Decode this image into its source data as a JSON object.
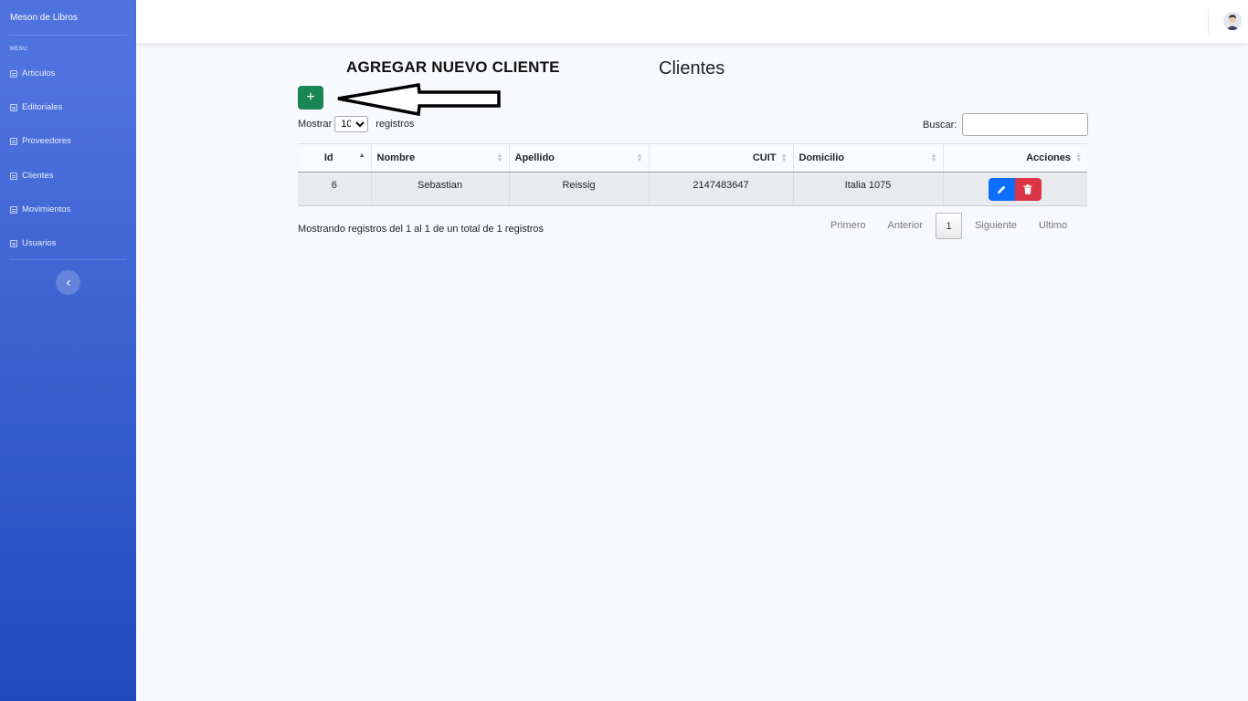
{
  "sidebar": {
    "brand": "Meson de Libros",
    "heading": "MENU",
    "items": [
      {
        "label": "Articulos",
        "icon": "list-icon"
      },
      {
        "label": "Editoriales",
        "icon": "list-icon"
      },
      {
        "label": "Proveedores",
        "icon": "list-icon"
      },
      {
        "label": "Clientes",
        "icon": "list-icon"
      },
      {
        "label": "Movimientos",
        "icon": "list-icon"
      },
      {
        "label": "Usuarios",
        "icon": "list-icon"
      }
    ],
    "toggle_icon": "chevron-left-icon"
  },
  "topbar": {
    "avatar_icon": "user-avatar-icon"
  },
  "page": {
    "title": "Clientes",
    "annotation": "AGREGAR NUEVO CLIENTE",
    "add_label": "+"
  },
  "table_controls": {
    "show_label": "Mostrar",
    "show_value": "10",
    "show_suffix": "registros",
    "search_label": "Buscar:",
    "search_value": ""
  },
  "table": {
    "headers": [
      "Id",
      "Nombre",
      "Apellido",
      "CUIT",
      "Domicilio",
      "Acciones"
    ],
    "rows": [
      {
        "id": "6",
        "nombre": "Sebastian",
        "apellido": "Reissig",
        "cuit": "2147483647",
        "domicilio": "Italia 1075"
      }
    ]
  },
  "footer": {
    "info": "Mostrando registros del 1 al 1 de un total de 1 registros",
    "pager": {
      "first": "Primero",
      "prev": "Anterior",
      "current": "1",
      "next": "Siguiente",
      "last": "Ultimo"
    }
  },
  "colors": {
    "sidebar_top": "#4e73df",
    "sidebar_bottom": "#224abe",
    "add_button": "#198754",
    "edit_button": "#0d6efd",
    "delete_button": "#dc3545"
  }
}
